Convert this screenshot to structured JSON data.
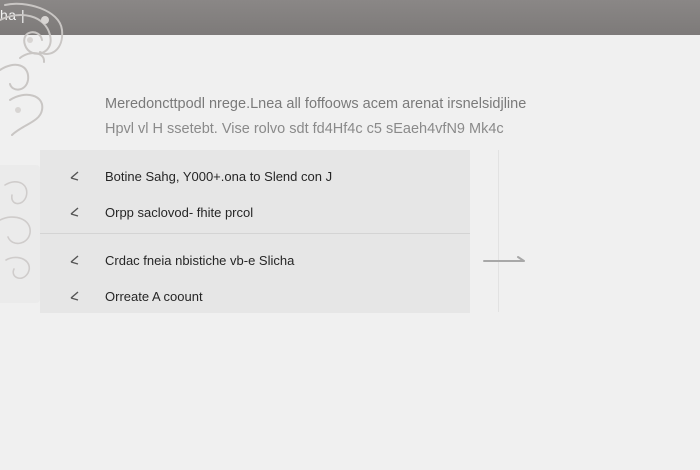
{
  "window": {
    "title": "ha |"
  },
  "message": {
    "line1": "Meredoncttpodl nrege.Lnea all foffoows acem arenat irsnelsidjline",
    "line2": "Hpvl vl H ssetebt. Vise rolvo sdt fd4Hf4c c5 sEaeh4vfN9 Mk4c"
  },
  "menu": {
    "items": [
      {
        "label": "Botine Sahg, Y000+.ona to Slend con J",
        "icon": "chevron-icon"
      },
      {
        "label": "Orpp saclovod- fhite prcol",
        "icon": "chevron-icon"
      },
      {
        "label": "Crdac fneia nbistiche vb-e Slicha",
        "icon": "chevron-icon"
      },
      {
        "label": "Orreate A coount",
        "icon": "chevron-icon"
      }
    ]
  },
  "colors": {
    "background": "#f0f0f0",
    "topbar": "#858281",
    "card": "#e6e6e6"
  }
}
